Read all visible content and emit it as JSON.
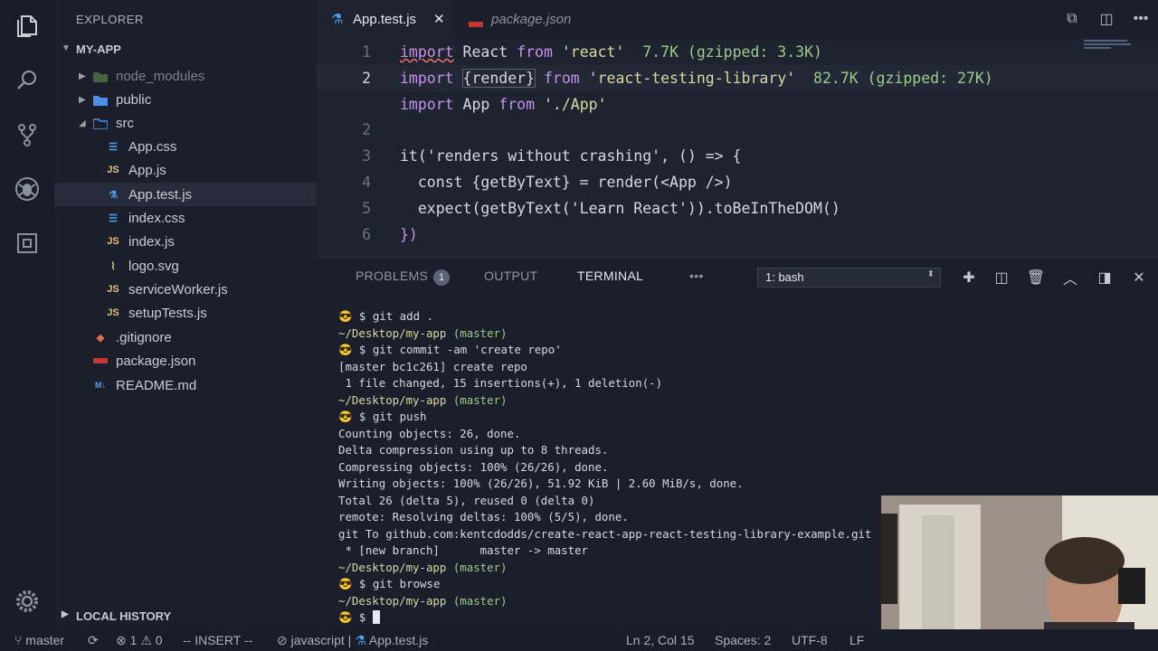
{
  "sidebar": {
    "title": "EXPLORER",
    "project": "MY-APP",
    "items": [
      {
        "label": "node_modules",
        "type": "folder",
        "expanded": false
      },
      {
        "label": "public",
        "type": "folder",
        "expanded": false
      },
      {
        "label": "src",
        "type": "folder",
        "expanded": true
      },
      {
        "label": "App.css",
        "type": "css"
      },
      {
        "label": "App.js",
        "type": "js"
      },
      {
        "label": "App.test.js",
        "type": "test",
        "selected": true
      },
      {
        "label": "index.css",
        "type": "css"
      },
      {
        "label": "index.js",
        "type": "js"
      },
      {
        "label": "logo.svg",
        "type": "svg"
      },
      {
        "label": "serviceWorker.js",
        "type": "js"
      },
      {
        "label": "setupTests.js",
        "type": "js"
      },
      {
        "label": ".gitignore",
        "type": "git"
      },
      {
        "label": "package.json",
        "type": "npm"
      },
      {
        "label": "README.md",
        "type": "md"
      }
    ],
    "local_history": "LOCAL HISTORY"
  },
  "tabs": [
    {
      "label": "App.test.js",
      "active": true
    },
    {
      "label": "package.json",
      "active": false
    }
  ],
  "editor": {
    "lines": [
      {
        "num": "1",
        "kw": "import",
        "name": "React",
        "from": "from",
        "mod": "'react'",
        "size": "7.7K (gzipped: 3.3K)"
      },
      {
        "num": "2",
        "kw": "import",
        "name": "{render}",
        "from": "from",
        "mod": "'react-testing-library'",
        "size": "82.7K (gzipped: 27K)"
      },
      {
        "num": "",
        "kw": "import",
        "name": "App",
        "from": "from",
        "mod": "'./App'",
        "size": ""
      },
      {
        "num": "2"
      },
      {
        "num": "3",
        "text": "it('renders without crashing', () => {"
      },
      {
        "num": "4",
        "text": "  const {getByText} = render(<App />)"
      },
      {
        "num": "5",
        "text": "  expect(getByText('Learn React')).toBeInTheDOM()"
      },
      {
        "num": "6",
        "text": "})"
      }
    ]
  },
  "panel": {
    "tabs": {
      "problems": "PROBLEMS",
      "problems_count": "1",
      "output": "OUTPUT",
      "terminal": "TERMINAL",
      "more": "•••"
    },
    "shell": "1: bash",
    "terminal_lines": [
      {
        "kind": "cmd",
        "text": "git add ."
      },
      {
        "kind": "path",
        "path": "~/Desktop/my-app",
        "branch": "(master)"
      },
      {
        "kind": "cmd",
        "text": "git commit -am 'create repo'"
      },
      {
        "kind": "out",
        "text": "[master bc1c261] create repo"
      },
      {
        "kind": "out",
        "text": " 1 file changed, 15 insertions(+), 1 deletion(-)"
      },
      {
        "kind": "path",
        "path": "~/Desktop/my-app",
        "branch": "(master)"
      },
      {
        "kind": "cmd",
        "text": "git push"
      },
      {
        "kind": "out",
        "text": "Counting objects: 26, done."
      },
      {
        "kind": "out",
        "text": "Delta compression using up to 8 threads."
      },
      {
        "kind": "out",
        "text": "Compressing objects: 100% (26/26), done."
      },
      {
        "kind": "out",
        "text": "Writing objects: 100% (26/26), 51.92 KiB | 2.60 MiB/s, done."
      },
      {
        "kind": "out",
        "text": "Total 26 (delta 5), reused 0 (delta 0)"
      },
      {
        "kind": "out",
        "text": "remote: Resolving deltas: 100% (5/5), done."
      },
      {
        "kind": "out",
        "text": "git To github.com:kentcdodds/create-react-app-react-testing-library-example.git"
      },
      {
        "kind": "out",
        "text": " * [new branch]      master -> master"
      },
      {
        "kind": "path",
        "path": "~/Desktop/my-app",
        "branch": "(master)"
      },
      {
        "kind": "cmd",
        "text": "git browse"
      },
      {
        "kind": "path",
        "path": "~/Desktop/my-app",
        "branch": "(master)"
      },
      {
        "kind": "prompt",
        "text": ""
      }
    ],
    "prompt_symbol": "😎 $"
  },
  "statusbar": {
    "branch": "master",
    "errors": "1",
    "warnings": "0",
    "mode": "-- INSERT --",
    "language": "javascript",
    "separator": "|",
    "file": "App.test.js",
    "position": "Ln 2, Col 15",
    "spaces": "Spaces: 2",
    "encoding": "UTF-8",
    "eol": "LF"
  },
  "colors": {
    "background": "#1e2330",
    "sidebar": "#1b1f2b",
    "keyword": "#c792ea",
    "string": "#d8d8a4",
    "size_hint": "#9ccb8a",
    "function": "#82aaff",
    "tab_icon": "#4fa3f7"
  }
}
